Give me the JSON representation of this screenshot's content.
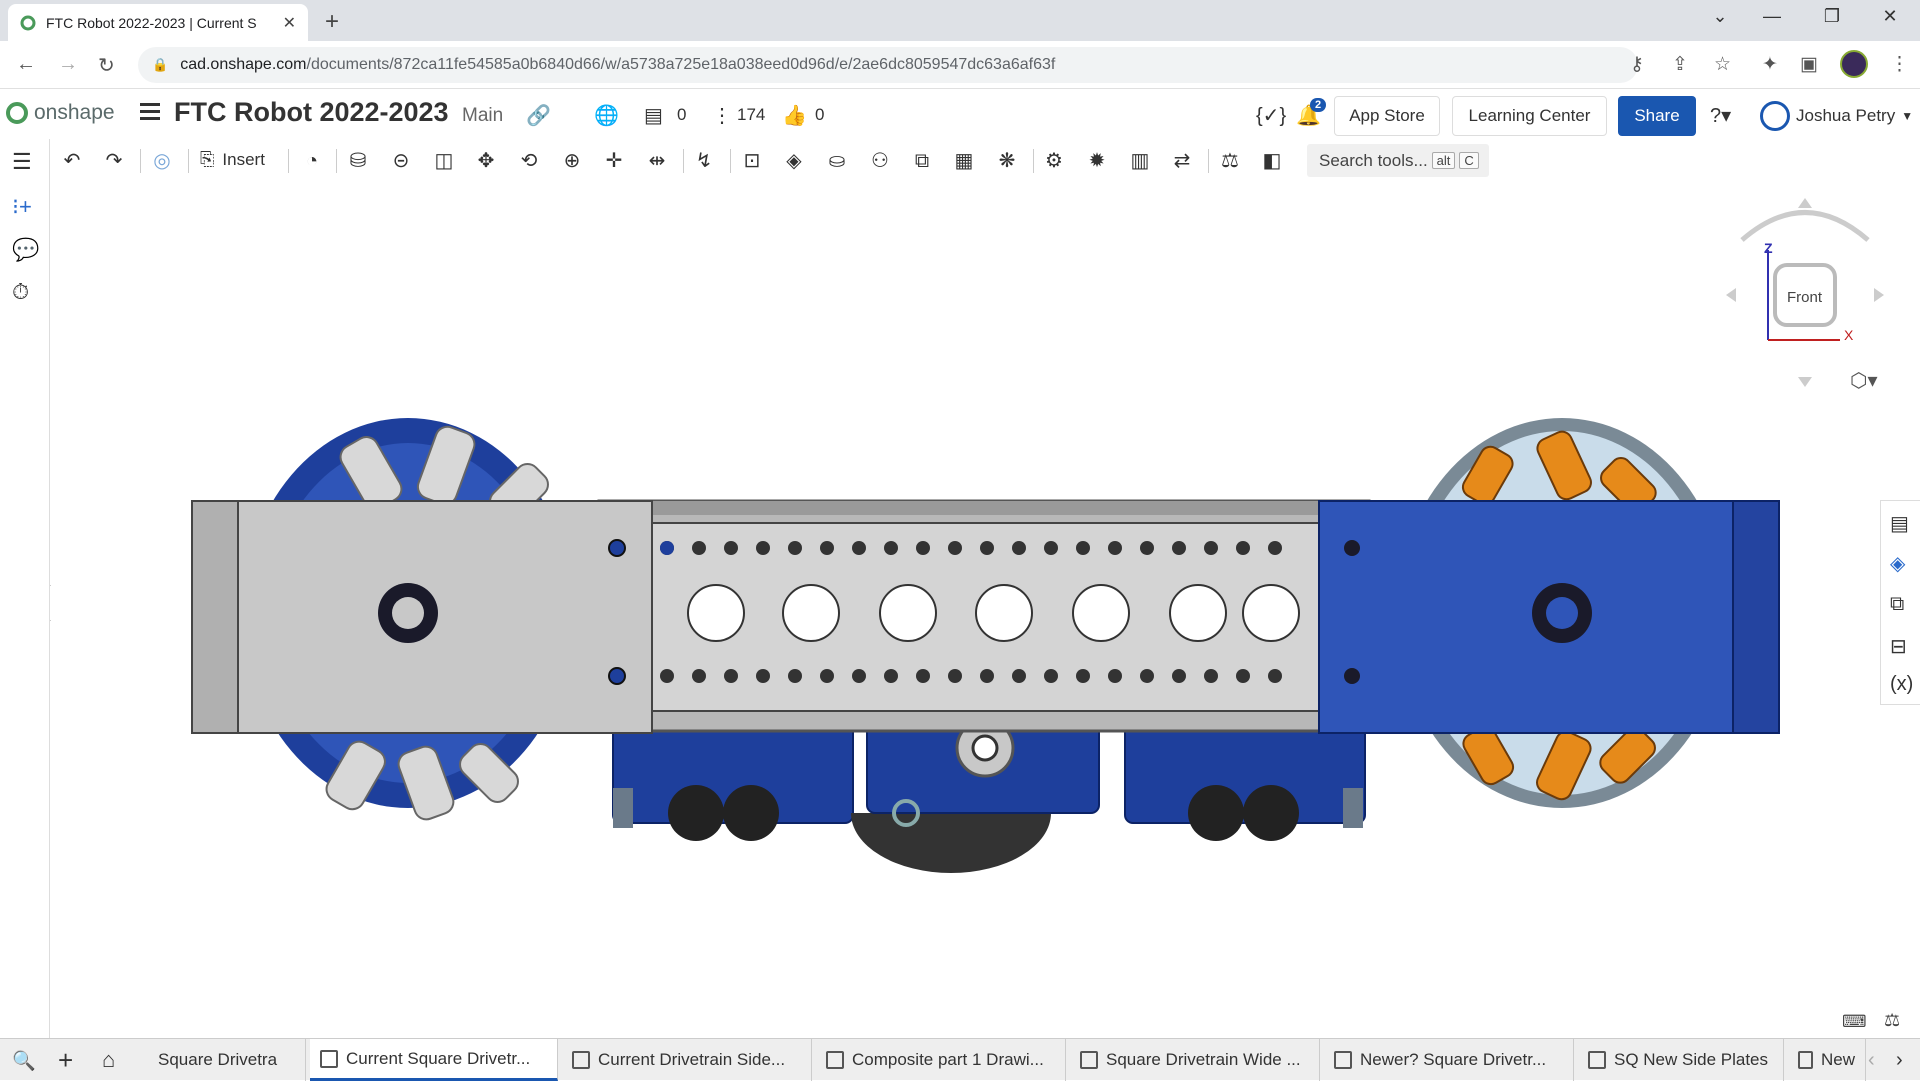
{
  "browser": {
    "tab_title": "FTC Robot 2022-2023 | Current S",
    "url_host": "cad.onshape.com",
    "url_path": "/documents/872ca11fe54585a0b6840d66/w/a5738a725e18a038eed0d96d/e/2ae6dc8059547dc63a6af63f"
  },
  "header": {
    "brand": "onshape",
    "doc_title": "FTC Robot 2022-2023",
    "branch": "Main",
    "versions_count": "0",
    "instances_count": "174",
    "likes_count": "0",
    "notifications_count": "2",
    "app_store_label": "App Store",
    "learning_center_label": "Learning Center",
    "share_label": "Share",
    "user_name": "Joshua Petry"
  },
  "toolbar": {
    "insert_label": "Insert",
    "search_label": "Search tools...",
    "search_shortcut_1": "alt",
    "search_shortcut_2": "C"
  },
  "viewcube": {
    "face_label": "Front",
    "axis_z": "Z",
    "axis_x": "X"
  },
  "bottom_tabs": [
    {
      "label": "Square Drivetra",
      "active": false
    },
    {
      "label": "Current Square Drivetr...",
      "active": true
    },
    {
      "label": "Current Drivetrain Side...",
      "active": false
    },
    {
      "label": "Composite part 1 Drawi...",
      "active": false
    },
    {
      "label": "Square Drivetrain Wide ...",
      "active": false
    },
    {
      "label": "Newer? Square Drivetr...",
      "active": false
    },
    {
      "label": "SQ New Side Plates",
      "active": false
    },
    {
      "label": "New",
      "active": false
    }
  ],
  "colors": {
    "accent": "#1a57b0",
    "wheel_blue": "#1e3f9c",
    "plate_gray": "#c8c8c8",
    "roller_orange": "#e68a1a",
    "wheel_light": "#c9dcea"
  }
}
